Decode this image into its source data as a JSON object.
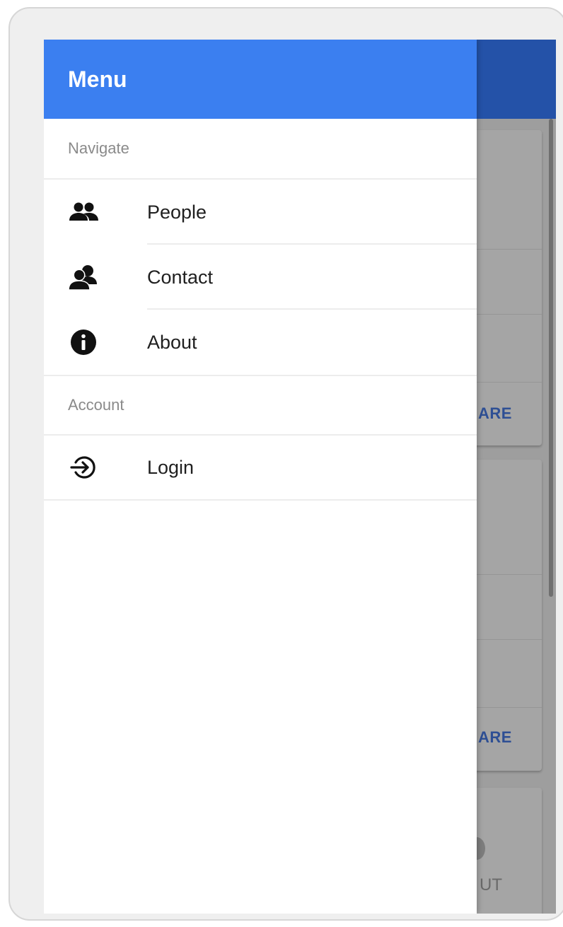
{
  "drawer": {
    "title": "Menu",
    "header_color": "#3b7ff0",
    "sections": [
      {
        "header": "Navigate",
        "items": [
          {
            "label": "People",
            "icon": "people-icon"
          },
          {
            "label": "Contact",
            "icon": "contact-icon"
          },
          {
            "label": "About",
            "icon": "info-icon"
          }
        ]
      },
      {
        "header": "Account",
        "items": [
          {
            "label": "Login",
            "icon": "login-icon"
          }
        ]
      }
    ]
  },
  "background": {
    "share_label_1": "ARE",
    "share_label_2": "ARE",
    "bottom_label": "UT",
    "appbar_color": "#2452a8"
  }
}
